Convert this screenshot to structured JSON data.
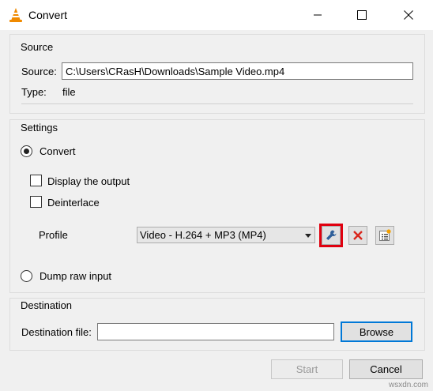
{
  "window": {
    "title": "Convert",
    "icon": "vlc-cone-icon"
  },
  "source_group": {
    "label": "Source",
    "source_label": "Source:",
    "source_value": "C:\\Users\\CRasH\\Downloads\\Sample Video.mp4",
    "type_label": "Type:",
    "type_value": "file"
  },
  "settings_group": {
    "label": "Settings",
    "convert_label": "Convert",
    "display_output_label": "Display the output",
    "deinterlace_label": "Deinterlace",
    "profile_label": "Profile",
    "profile_value": "Video - H.264 + MP3 (MP4)",
    "dump_raw_label": "Dump raw input",
    "convert_selected": true,
    "display_output_checked": false,
    "deinterlace_checked": false
  },
  "destination_group": {
    "label": "Destination",
    "dest_file_label": "Destination file:",
    "dest_file_value": "",
    "browse_label": "Browse"
  },
  "footer": {
    "start_label": "Start",
    "cancel_label": "Cancel"
  },
  "watermark": "wsxdn.com",
  "colors": {
    "highlight": "#e0000f",
    "delete_red": "#d9261c",
    "accent": "#0078d7"
  }
}
